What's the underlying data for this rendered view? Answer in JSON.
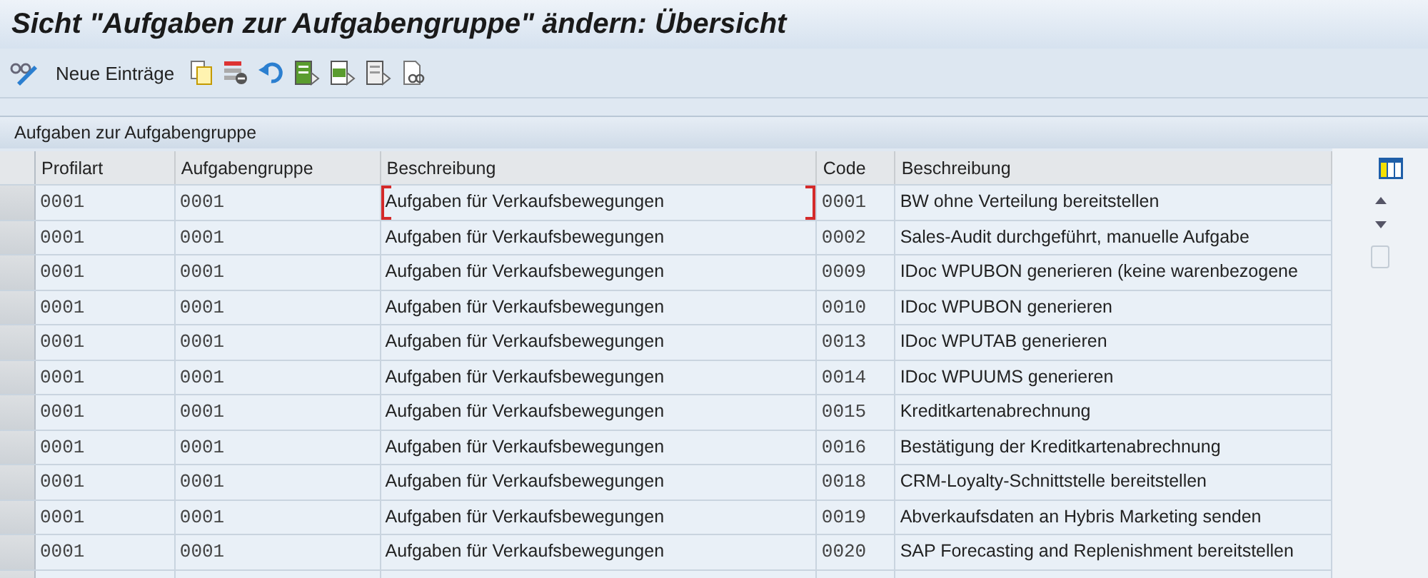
{
  "window": {
    "title": "Sicht \"Aufgaben zur Aufgabengruppe\" ändern: Übersicht"
  },
  "toolbar": {
    "new_entries": "Neue Einträge"
  },
  "table": {
    "title": "Aufgaben zur Aufgabengruppe",
    "columns": [
      "Profilart",
      "Aufgabengruppe",
      "Beschreibung",
      "Code",
      "Beschreibung"
    ],
    "rows": [
      {
        "profilart": "0001",
        "gruppe": "0001",
        "gruppe_text": "Aufgaben für Verkaufsbewegungen",
        "code": "0001",
        "code_text": "BW ohne Verteilung bereitstellen",
        "focused": true
      },
      {
        "profilart": "0001",
        "gruppe": "0001",
        "gruppe_text": "Aufgaben für Verkaufsbewegungen",
        "code": "0002",
        "code_text": "Sales-Audit durchgeführt, manuelle Aufgabe",
        "focused": false
      },
      {
        "profilart": "0001",
        "gruppe": "0001",
        "gruppe_text": "Aufgaben für Verkaufsbewegungen",
        "code": "0009",
        "code_text": "IDoc WPUBON generieren (keine warenbezogene",
        "focused": false
      },
      {
        "profilart": "0001",
        "gruppe": "0001",
        "gruppe_text": "Aufgaben für Verkaufsbewegungen",
        "code": "0010",
        "code_text": "IDoc WPUBON generieren",
        "focused": false
      },
      {
        "profilart": "0001",
        "gruppe": "0001",
        "gruppe_text": "Aufgaben für Verkaufsbewegungen",
        "code": "0013",
        "code_text": "IDoc WPUTAB generieren",
        "focused": false
      },
      {
        "profilart": "0001",
        "gruppe": "0001",
        "gruppe_text": "Aufgaben für Verkaufsbewegungen",
        "code": "0014",
        "code_text": "IDoc WPUUMS generieren",
        "focused": false
      },
      {
        "profilart": "0001",
        "gruppe": "0001",
        "gruppe_text": "Aufgaben für Verkaufsbewegungen",
        "code": "0015",
        "code_text": "Kreditkartenabrechnung",
        "focused": false
      },
      {
        "profilart": "0001",
        "gruppe": "0001",
        "gruppe_text": "Aufgaben für Verkaufsbewegungen",
        "code": "0016",
        "code_text": "Bestätigung der Kreditkartenabrechnung",
        "focused": false
      },
      {
        "profilart": "0001",
        "gruppe": "0001",
        "gruppe_text": "Aufgaben für Verkaufsbewegungen",
        "code": "0018",
        "code_text": "CRM-Loyalty-Schnittstelle bereitstellen",
        "focused": false
      },
      {
        "profilart": "0001",
        "gruppe": "0001",
        "gruppe_text": "Aufgaben für Verkaufsbewegungen",
        "code": "0019",
        "code_text": "Abverkaufsdaten an Hybris Marketing senden",
        "focused": false
      },
      {
        "profilart": "0001",
        "gruppe": "0001",
        "gruppe_text": "Aufgaben für Verkaufsbewegungen",
        "code": "0020",
        "code_text": "SAP Forecasting and Replenishment bereitstellen",
        "focused": false
      }
    ]
  }
}
